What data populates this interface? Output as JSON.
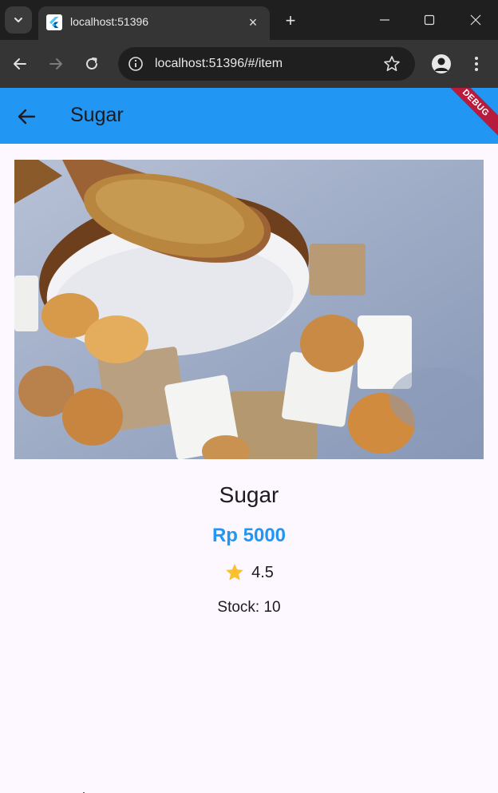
{
  "browser": {
    "tab_title": "localhost:51396",
    "url": "localhost:51396/#/item",
    "new_tab_symbol": "+",
    "close_tab_symbol": "×"
  },
  "appbar": {
    "title": "Sugar",
    "debug_label": "DEBUG",
    "color": "#2196f3"
  },
  "product": {
    "name": "Sugar",
    "price": "Rp 5000",
    "rating": "4.5",
    "stock": "Stock: 10",
    "price_color": "#2196f3",
    "star_color": "#fbc02d"
  }
}
